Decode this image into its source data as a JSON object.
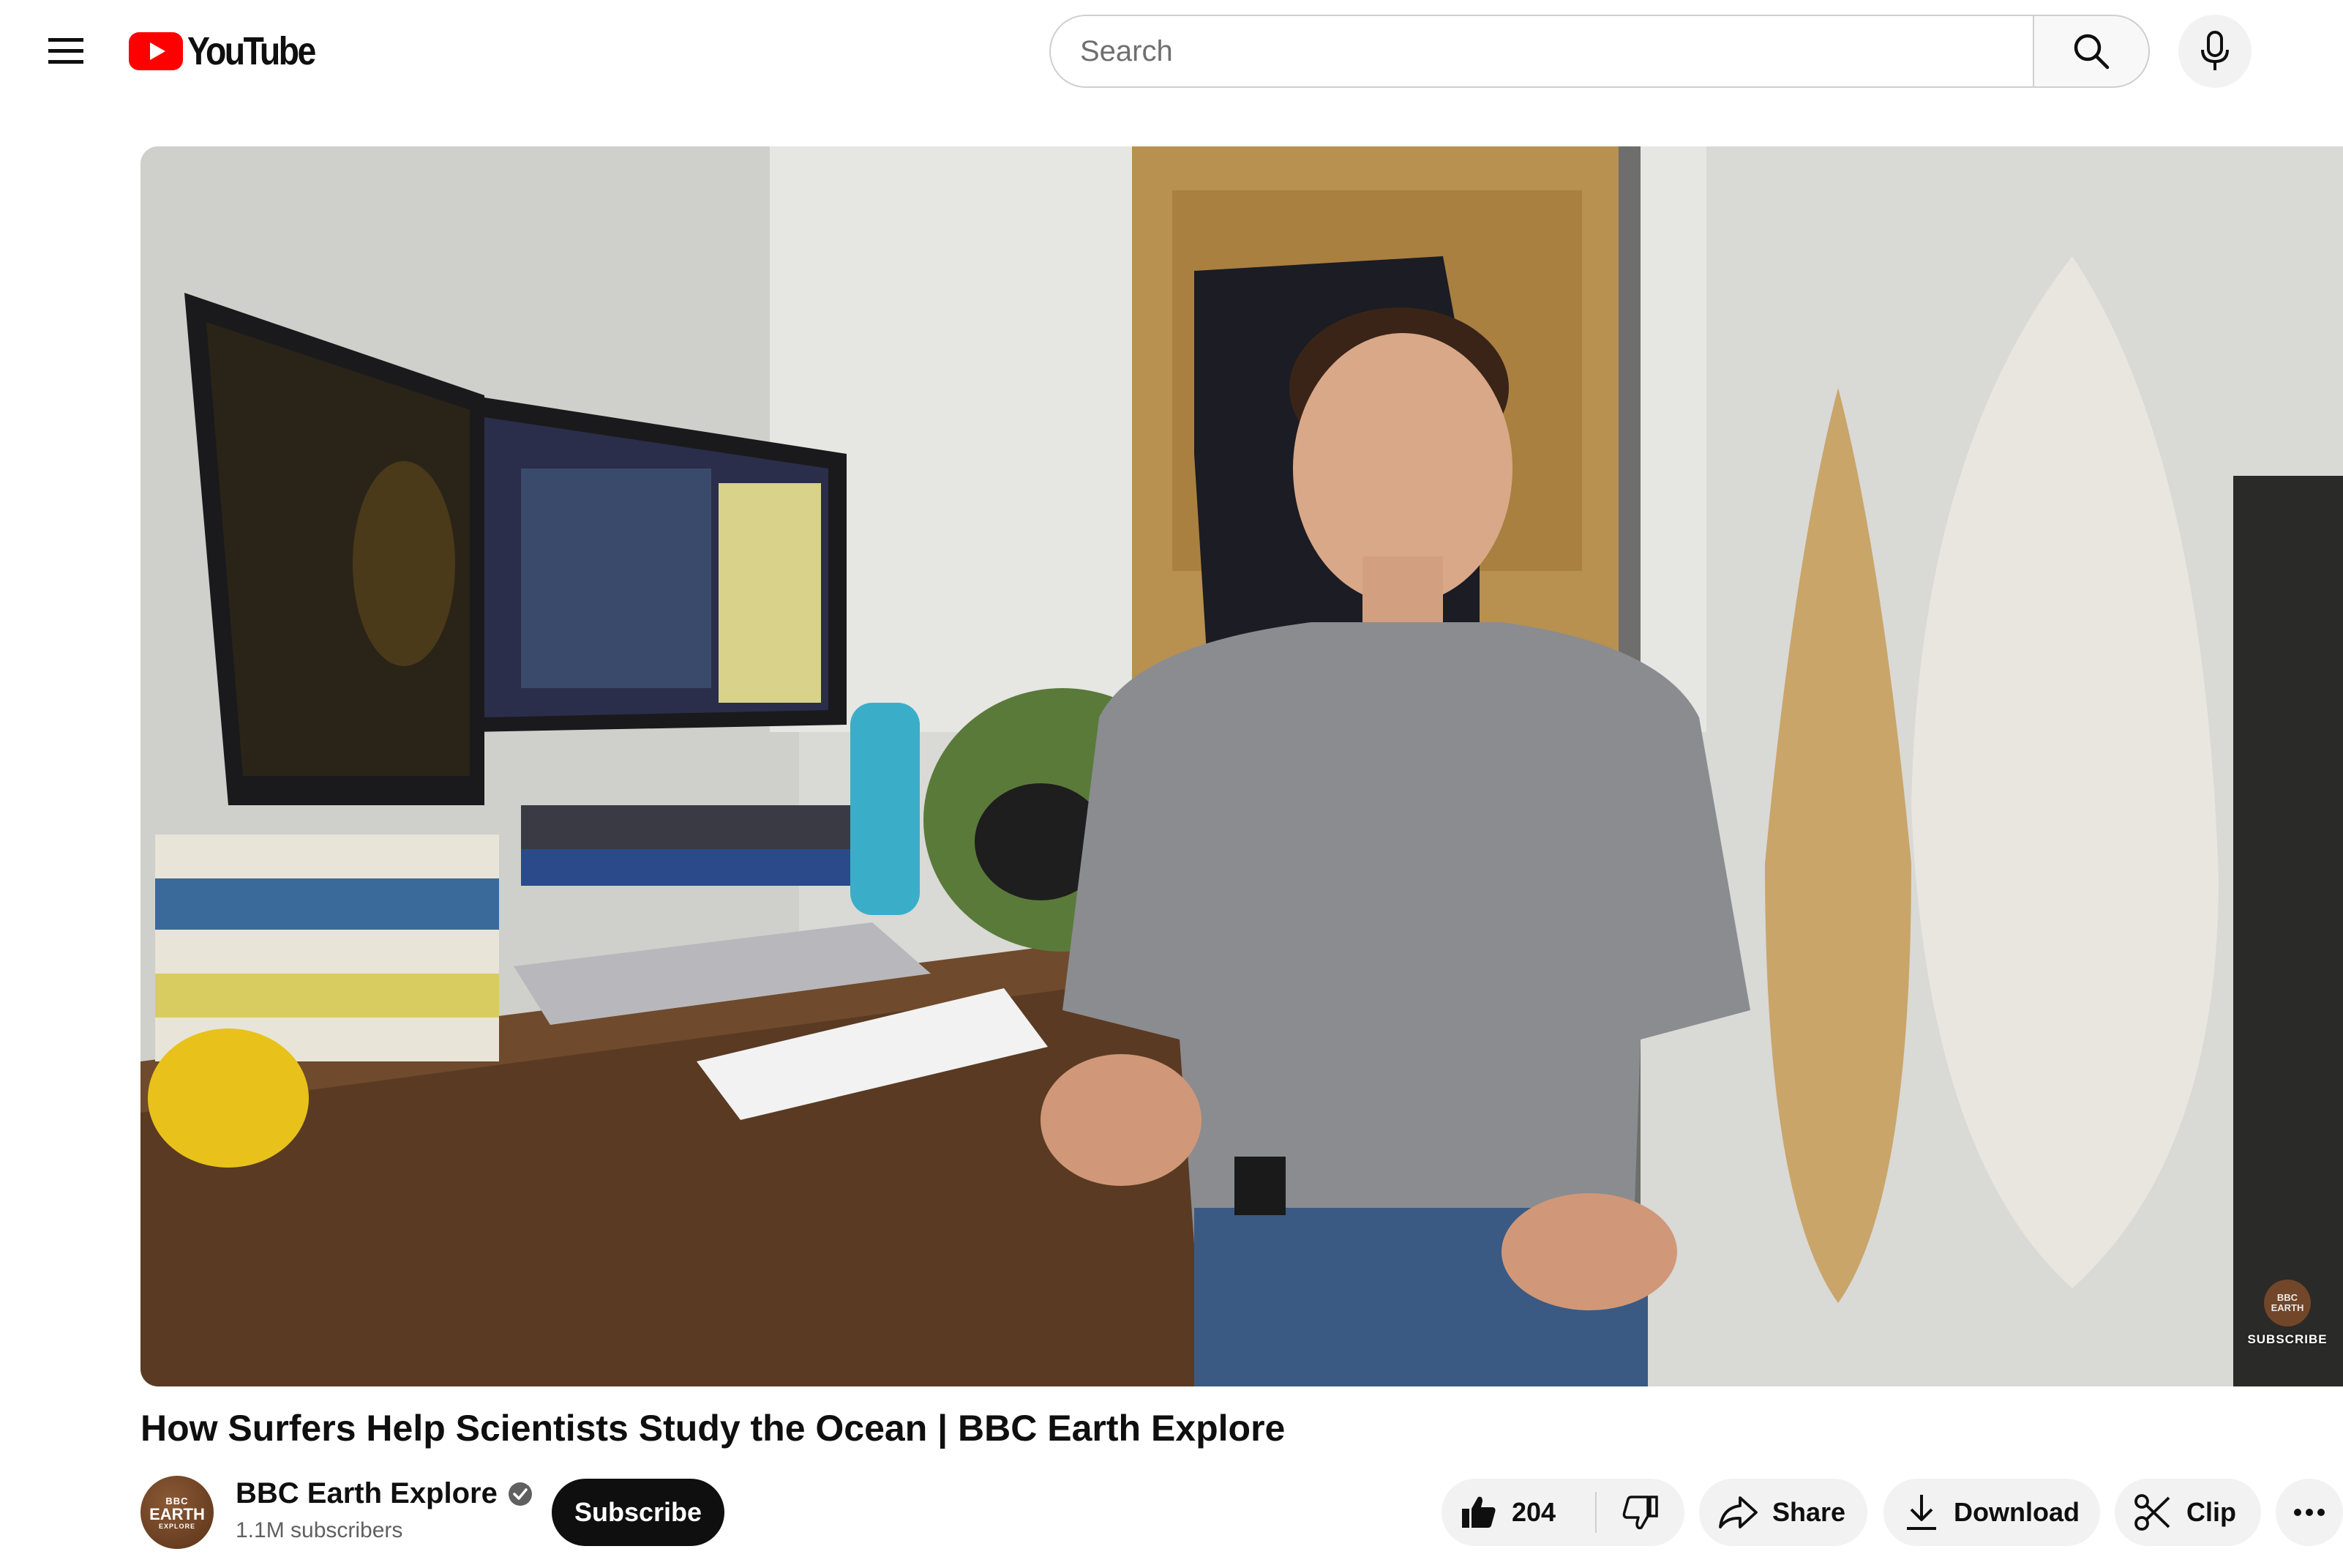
{
  "header": {
    "logo_text": "YouTube",
    "search_placeholder": "Search",
    "icons": [
      "menu-icon",
      "youtube-logo-icon",
      "search-icon",
      "mic-icon"
    ]
  },
  "player": {
    "watermark_logo_line1": "BBC",
    "watermark_logo_line2": "EARTH",
    "watermark_label": "SUBSCRIBE"
  },
  "video": {
    "title": "How Surfers Help Scientists Study the Ocean | BBC Earth Explore"
  },
  "channel": {
    "name": "BBC Earth Explore",
    "subscribers": "1.1M subscribers",
    "subscribe_label": "Subscribe",
    "avatar_line1": "BBC",
    "avatar_line2": "EARTH",
    "avatar_line3": "EXPLORE"
  },
  "actions": {
    "like_count": "204",
    "share_label": "Share",
    "download_label": "Download",
    "clip_label": "Clip"
  },
  "colors": {
    "brand_red": "#ff0000",
    "pill_bg": "#f2f2f2",
    "subscribe_bg": "#0f0f0f"
  }
}
